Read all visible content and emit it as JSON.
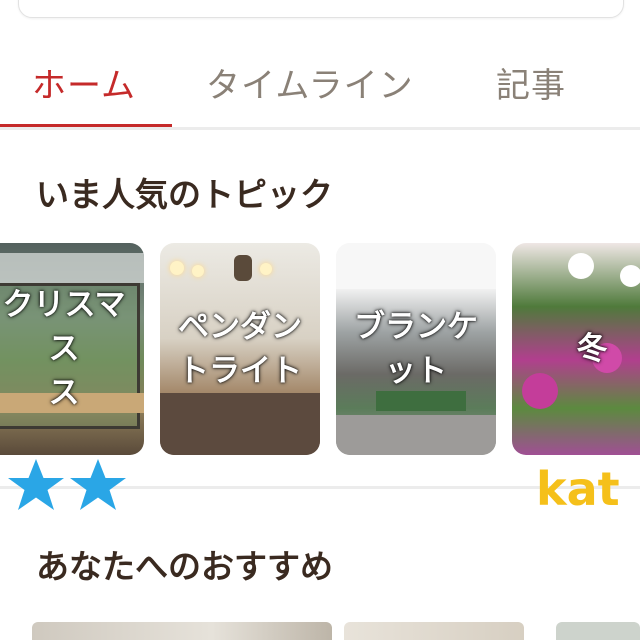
{
  "tabs": [
    {
      "label": "ホーム",
      "active": true
    },
    {
      "label": "タイムライン",
      "active": false
    },
    {
      "label": "記事",
      "active": false
    }
  ],
  "sections": {
    "popular_topics": "いま人気のトピック",
    "recommended": "あなたへのおすすめ"
  },
  "topics": [
    {
      "label": "クリスマス\nス"
    },
    {
      "label": "ペンダン\nトライト"
    },
    {
      "label": "ブランケ\nット"
    },
    {
      "label": "冬"
    }
  ],
  "overlay": {
    "watermark_text": "kat",
    "stars_color": "#2aa6e6",
    "watermark_color": "#f5c01a"
  },
  "colors": {
    "accent": "#c52a2a",
    "tab_inactive": "#8a8177",
    "heading": "#3a2a20"
  }
}
